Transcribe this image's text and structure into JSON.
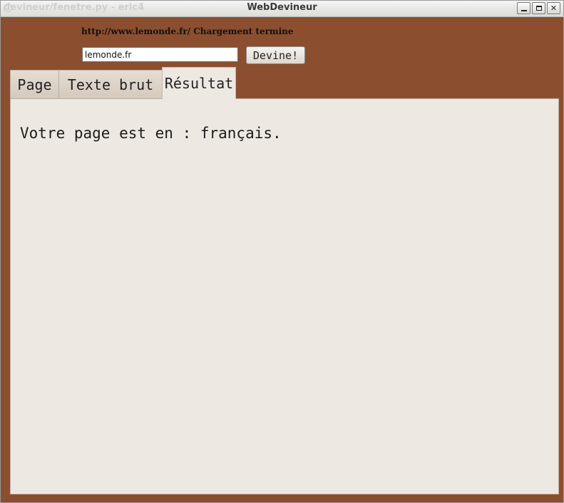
{
  "window": {
    "background_title": "devineur/fenetre.py - eric4",
    "title": "WebDevineur",
    "buttons": {
      "minimize": "minimize-icon",
      "maximize": "maximize-icon",
      "close": "close-icon",
      "close_glyph": "✕"
    },
    "frame_color": "#8b4f2f"
  },
  "status": {
    "text": "http://www.lemonde.fr/ Chargement termine"
  },
  "url_input": {
    "value": "lemonde.fr"
  },
  "go_button": {
    "label": "Devine!"
  },
  "tabs": [
    {
      "label": "Page",
      "active": false
    },
    {
      "label": "Texte brut",
      "active": false
    },
    {
      "label": "Résultat",
      "active": true
    }
  ],
  "result": {
    "text": "Votre page est en : français."
  }
}
